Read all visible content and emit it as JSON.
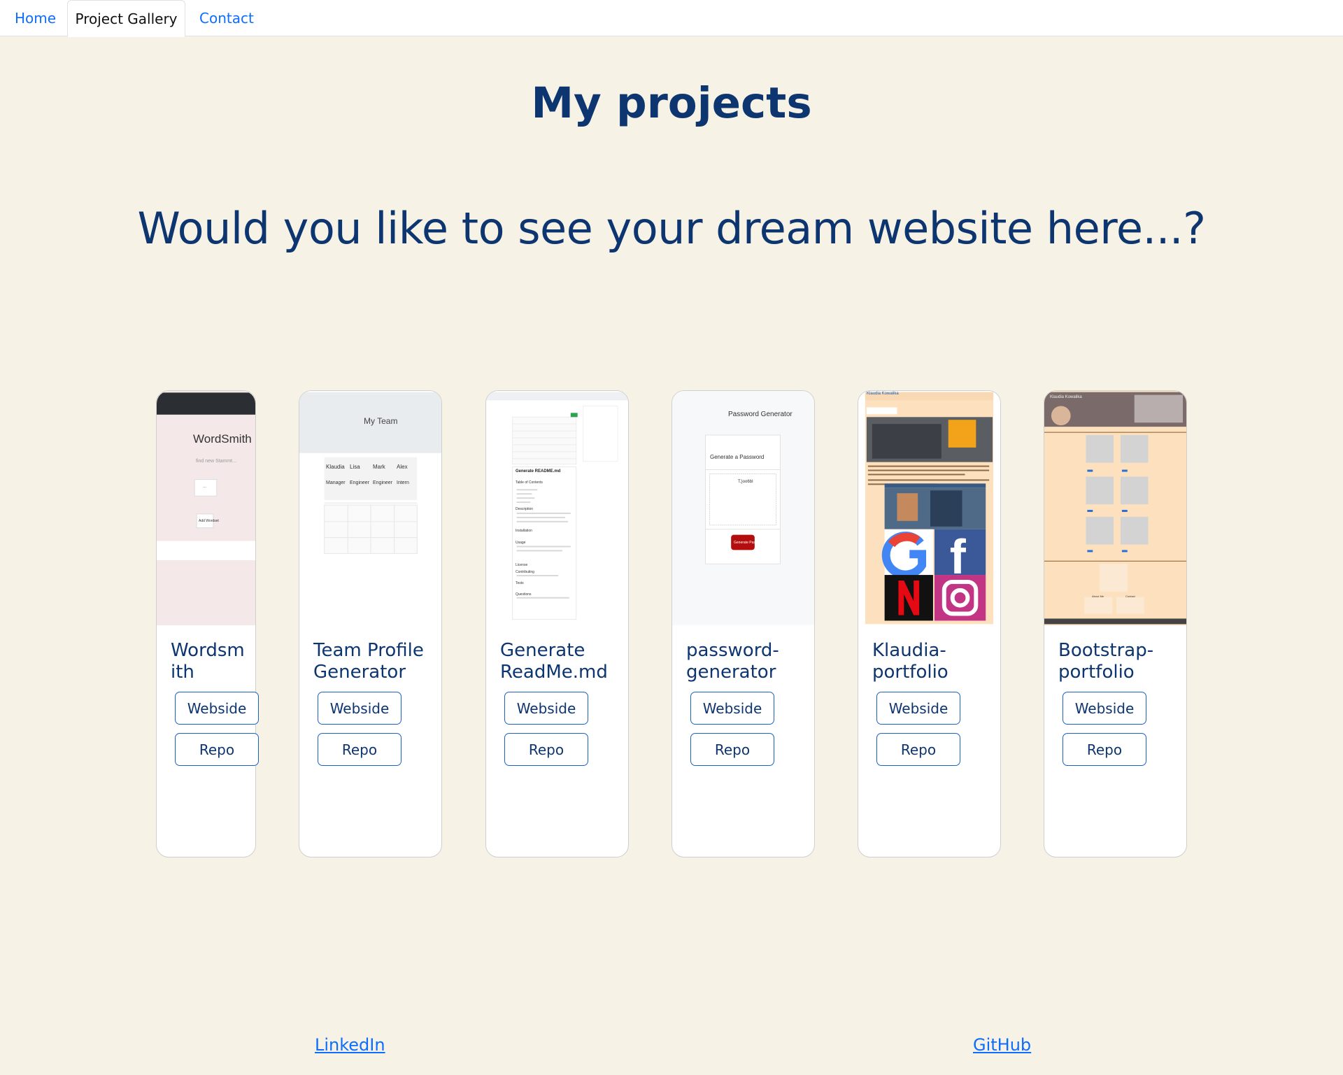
{
  "nav": {
    "tabs": [
      {
        "label": "Home",
        "active": false
      },
      {
        "label": "Project Gallery",
        "active": true
      },
      {
        "label": "Contact",
        "active": false
      }
    ]
  },
  "page": {
    "title": "My projects",
    "tagline": "Would you like to see your dream website here...?"
  },
  "projects": [
    {
      "title": "Wordsmith",
      "site_label": "Webside",
      "repo_label": "Repo",
      "thumb": {
        "heading": "WordSmith",
        "subtitle": "find new Stammt...",
        "button1": "...",
        "button2": "Add Wordset"
      }
    },
    {
      "title": "Team Profile Generator",
      "site_label": "Webside",
      "repo_label": "Repo",
      "thumb": {
        "heading": "My Team",
        "members": [
          "Klaudia",
          "Lisa",
          "Mark",
          "Alex"
        ],
        "roles": [
          "Manager",
          "Engineer",
          "Engineer",
          "Intern"
        ]
      }
    },
    {
      "title": "Generate ReadMe.md",
      "site_label": "Webside",
      "repo_label": "Repo",
      "thumb": {
        "heading": "Generate README.md",
        "sections": [
          "Table of Contents",
          "Description",
          "Installation",
          "Usage",
          "License",
          "Contributing",
          "Tests",
          "Questions"
        ]
      }
    },
    {
      "title": "password-generator",
      "site_label": "Webside",
      "repo_label": "Repo",
      "thumb": {
        "heading": "Password Generator",
        "card_title": "Generate a Password",
        "output": "T,}oo6bI",
        "button": "Generate Password"
      }
    },
    {
      "title": "Klaudia-portfolio",
      "site_label": "Webside",
      "repo_label": "Repo",
      "thumb": {
        "heading": "Klaudia Kowalika"
      }
    },
    {
      "title": "Bootstrap-portfolio",
      "site_label": "Webside",
      "repo_label": "Repo",
      "thumb": {
        "heading": "Klaudia Kowalika",
        "sections": [
          "About Me",
          "Contact"
        ]
      }
    }
  ],
  "footer": {
    "linkedin": "LinkedIn",
    "github": "GitHub"
  },
  "colors": {
    "background": "#f6f2e5",
    "heading": "#0d3570",
    "link": "#0d6efd",
    "button_border": "#1b62c4"
  }
}
